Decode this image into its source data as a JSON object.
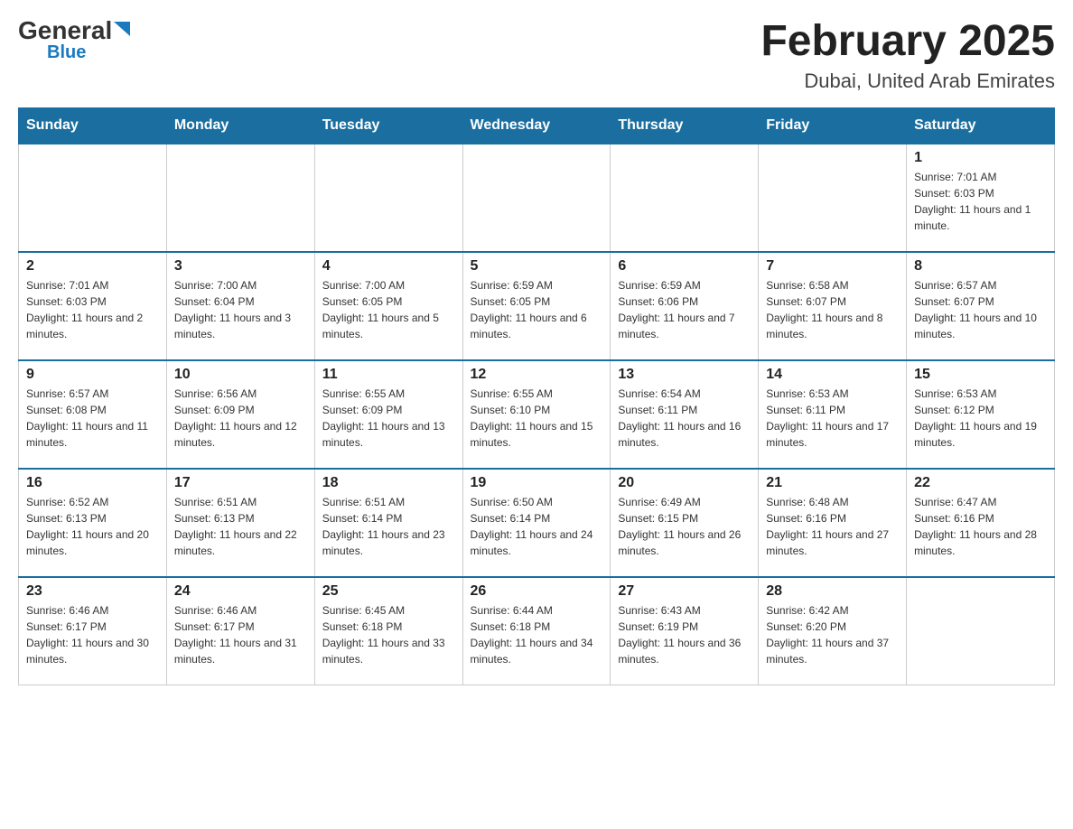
{
  "logo": {
    "general": "General",
    "blue": "Blue",
    "triangle": "▼"
  },
  "title": "February 2025",
  "subtitle": "Dubai, United Arab Emirates",
  "days": [
    "Sunday",
    "Monday",
    "Tuesday",
    "Wednesday",
    "Thursday",
    "Friday",
    "Saturday"
  ],
  "weeks": [
    [
      {
        "num": "",
        "info": ""
      },
      {
        "num": "",
        "info": ""
      },
      {
        "num": "",
        "info": ""
      },
      {
        "num": "",
        "info": ""
      },
      {
        "num": "",
        "info": ""
      },
      {
        "num": "",
        "info": ""
      },
      {
        "num": "1",
        "info": "Sunrise: 7:01 AM\nSunset: 6:03 PM\nDaylight: 11 hours and 1 minute."
      }
    ],
    [
      {
        "num": "2",
        "info": "Sunrise: 7:01 AM\nSunset: 6:03 PM\nDaylight: 11 hours and 2 minutes."
      },
      {
        "num": "3",
        "info": "Sunrise: 7:00 AM\nSunset: 6:04 PM\nDaylight: 11 hours and 3 minutes."
      },
      {
        "num": "4",
        "info": "Sunrise: 7:00 AM\nSunset: 6:05 PM\nDaylight: 11 hours and 5 minutes."
      },
      {
        "num": "5",
        "info": "Sunrise: 6:59 AM\nSunset: 6:05 PM\nDaylight: 11 hours and 6 minutes."
      },
      {
        "num": "6",
        "info": "Sunrise: 6:59 AM\nSunset: 6:06 PM\nDaylight: 11 hours and 7 minutes."
      },
      {
        "num": "7",
        "info": "Sunrise: 6:58 AM\nSunset: 6:07 PM\nDaylight: 11 hours and 8 minutes."
      },
      {
        "num": "8",
        "info": "Sunrise: 6:57 AM\nSunset: 6:07 PM\nDaylight: 11 hours and 10 minutes."
      }
    ],
    [
      {
        "num": "9",
        "info": "Sunrise: 6:57 AM\nSunset: 6:08 PM\nDaylight: 11 hours and 11 minutes."
      },
      {
        "num": "10",
        "info": "Sunrise: 6:56 AM\nSunset: 6:09 PM\nDaylight: 11 hours and 12 minutes."
      },
      {
        "num": "11",
        "info": "Sunrise: 6:55 AM\nSunset: 6:09 PM\nDaylight: 11 hours and 13 minutes."
      },
      {
        "num": "12",
        "info": "Sunrise: 6:55 AM\nSunset: 6:10 PM\nDaylight: 11 hours and 15 minutes."
      },
      {
        "num": "13",
        "info": "Sunrise: 6:54 AM\nSunset: 6:11 PM\nDaylight: 11 hours and 16 minutes."
      },
      {
        "num": "14",
        "info": "Sunrise: 6:53 AM\nSunset: 6:11 PM\nDaylight: 11 hours and 17 minutes."
      },
      {
        "num": "15",
        "info": "Sunrise: 6:53 AM\nSunset: 6:12 PM\nDaylight: 11 hours and 19 minutes."
      }
    ],
    [
      {
        "num": "16",
        "info": "Sunrise: 6:52 AM\nSunset: 6:13 PM\nDaylight: 11 hours and 20 minutes."
      },
      {
        "num": "17",
        "info": "Sunrise: 6:51 AM\nSunset: 6:13 PM\nDaylight: 11 hours and 22 minutes."
      },
      {
        "num": "18",
        "info": "Sunrise: 6:51 AM\nSunset: 6:14 PM\nDaylight: 11 hours and 23 minutes."
      },
      {
        "num": "19",
        "info": "Sunrise: 6:50 AM\nSunset: 6:14 PM\nDaylight: 11 hours and 24 minutes."
      },
      {
        "num": "20",
        "info": "Sunrise: 6:49 AM\nSunset: 6:15 PM\nDaylight: 11 hours and 26 minutes."
      },
      {
        "num": "21",
        "info": "Sunrise: 6:48 AM\nSunset: 6:16 PM\nDaylight: 11 hours and 27 minutes."
      },
      {
        "num": "22",
        "info": "Sunrise: 6:47 AM\nSunset: 6:16 PM\nDaylight: 11 hours and 28 minutes."
      }
    ],
    [
      {
        "num": "23",
        "info": "Sunrise: 6:46 AM\nSunset: 6:17 PM\nDaylight: 11 hours and 30 minutes."
      },
      {
        "num": "24",
        "info": "Sunrise: 6:46 AM\nSunset: 6:17 PM\nDaylight: 11 hours and 31 minutes."
      },
      {
        "num": "25",
        "info": "Sunrise: 6:45 AM\nSunset: 6:18 PM\nDaylight: 11 hours and 33 minutes."
      },
      {
        "num": "26",
        "info": "Sunrise: 6:44 AM\nSunset: 6:18 PM\nDaylight: 11 hours and 34 minutes."
      },
      {
        "num": "27",
        "info": "Sunrise: 6:43 AM\nSunset: 6:19 PM\nDaylight: 11 hours and 36 minutes."
      },
      {
        "num": "28",
        "info": "Sunrise: 6:42 AM\nSunset: 6:20 PM\nDaylight: 11 hours and 37 minutes."
      },
      {
        "num": "",
        "info": ""
      }
    ]
  ]
}
